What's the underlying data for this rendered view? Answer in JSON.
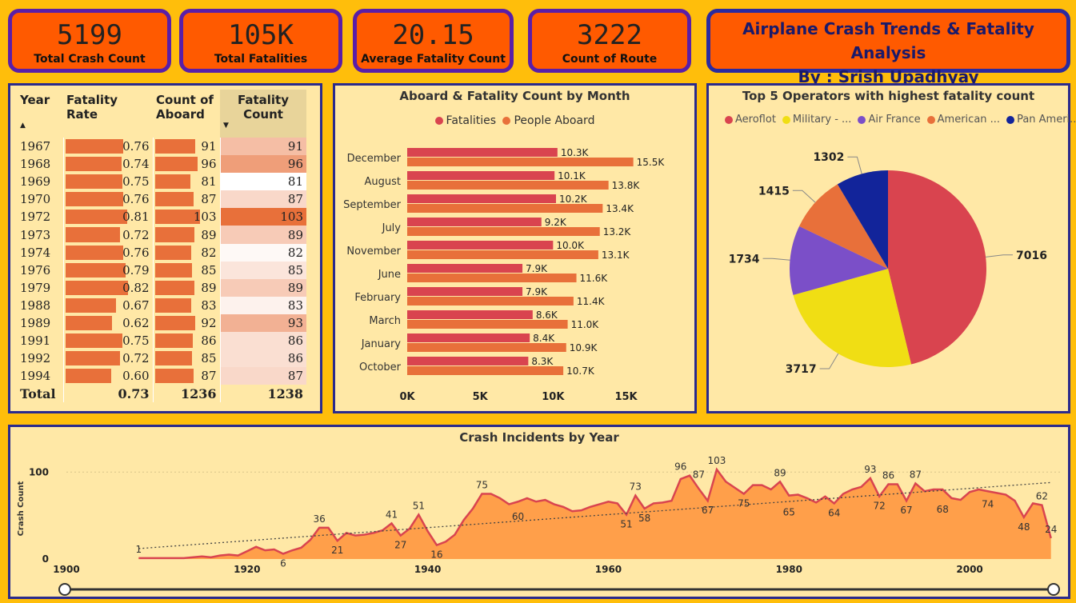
{
  "kpis": [
    {
      "value": "5199",
      "label": "Total Crash Count"
    },
    {
      "value": "105K",
      "label": "Total Fatalities"
    },
    {
      "value": "20.15",
      "label": "Average Fatality Count"
    },
    {
      "value": "3222",
      "label": "Count of Route"
    }
  ],
  "title": {
    "line1": "Airplane Crash Trends & Fatality Analysis",
    "line2": "By : Srish Upadhyay"
  },
  "table": {
    "headers": [
      "Year",
      "Fatality Rate",
      "Count of Aboard",
      "Fatality Count"
    ],
    "rows": [
      {
        "year": "1967",
        "rate": 0.76,
        "rate_txt": "0.76",
        "aboard": 91,
        "fat": 91
      },
      {
        "year": "1968",
        "rate": 0.74,
        "rate_txt": "0.74",
        "aboard": 96,
        "fat": 96
      },
      {
        "year": "1969",
        "rate": 0.75,
        "rate_txt": "0.75",
        "aboard": 81,
        "fat": 81
      },
      {
        "year": "1970",
        "rate": 0.76,
        "rate_txt": "0.76",
        "aboard": 87,
        "fat": 87
      },
      {
        "year": "1972",
        "rate": 0.81,
        "rate_txt": "0.81",
        "aboard": 103,
        "fat": 103
      },
      {
        "year": "1973",
        "rate": 0.72,
        "rate_txt": "0.72",
        "aboard": 89,
        "fat": 89
      },
      {
        "year": "1974",
        "rate": 0.76,
        "rate_txt": "0.76",
        "aboard": 82,
        "fat": 82
      },
      {
        "year": "1976",
        "rate": 0.79,
        "rate_txt": "0.79",
        "aboard": 85,
        "fat": 85
      },
      {
        "year": "1979",
        "rate": 0.82,
        "rate_txt": "0.82",
        "aboard": 89,
        "fat": 89
      },
      {
        "year": "1988",
        "rate": 0.67,
        "rate_txt": "0.67",
        "aboard": 83,
        "fat": 83
      },
      {
        "year": "1989",
        "rate": 0.62,
        "rate_txt": "0.62",
        "aboard": 92,
        "fat": 93
      },
      {
        "year": "1991",
        "rate": 0.75,
        "rate_txt": "0.75",
        "aboard": 86,
        "fat": 86
      },
      {
        "year": "1992",
        "rate": 0.72,
        "rate_txt": "0.72",
        "aboard": 85,
        "fat": 86
      },
      {
        "year": "1994",
        "rate": 0.6,
        "rate_txt": "0.60",
        "aboard": 87,
        "fat": 87
      }
    ],
    "total": {
      "label": "Total",
      "rate": "0.73",
      "aboard": "1236",
      "fat": "1238"
    },
    "colors": {
      "bar": "#E8703A"
    }
  },
  "chart_data": [
    {
      "type": "bar",
      "orientation": "horizontal",
      "title": "Aboard & Fatality Count by Month",
      "categories": [
        "December",
        "August",
        "September",
        "July",
        "November",
        "June",
        "February",
        "March",
        "January",
        "October"
      ],
      "series": [
        {
          "name": "Fatalities",
          "color": "#D9444F",
          "values": [
            10300,
            10100,
            10200,
            9200,
            10000,
            7900,
            7900,
            8600,
            8400,
            8300
          ],
          "labels": [
            "10.3K",
            "10.1K",
            "10.2K",
            "9.2K",
            "10.0K",
            "7.9K",
            "7.9K",
            "8.6K",
            "8.4K",
            "8.3K"
          ]
        },
        {
          "name": "People Aboard",
          "color": "#E8703A",
          "values": [
            15500,
            13800,
            13400,
            13200,
            13100,
            11600,
            11400,
            11000,
            10900,
            10700
          ],
          "labels": [
            "15.5K",
            "13.8K",
            "13.4K",
            "13.2K",
            "13.1K",
            "11.6K",
            "11.4K",
            "11.0K",
            "10.9K",
            "10.7K"
          ]
        }
      ],
      "xticks": [
        "0K",
        "5K",
        "10K",
        "15K"
      ],
      "xlim": [
        0,
        17000
      ],
      "legend": "top"
    },
    {
      "type": "pie",
      "title": "Top 5 Operators with highest fatality count",
      "legend_labels": [
        "Aeroflot",
        "Military - ...",
        "Air France",
        "American ...",
        "Pan Ameri..."
      ],
      "slices": [
        {
          "label": "Aeroflot",
          "value": 7016,
          "color": "#D9444F"
        },
        {
          "label": "Military",
          "value": 3717,
          "color": "#F0DE14"
        },
        {
          "label": "Air France",
          "value": 1734,
          "color": "#7B4FC8"
        },
        {
          "label": "American",
          "value": 1415,
          "color": "#E8703A"
        },
        {
          "label": "Pan American",
          "value": 1302,
          "color": "#12249A"
        }
      ],
      "legend": "top"
    },
    {
      "type": "area",
      "title": "Crash Incidents by Year",
      "ylabel": "Crash Count",
      "xticks": [
        "1900",
        "1920",
        "1940",
        "1960",
        "1980",
        "2000"
      ],
      "yticks": [
        "0",
        "100"
      ],
      "xlim": [
        1900,
        2010
      ],
      "ylim": [
        0,
        115
      ],
      "x": [
        1908,
        1910,
        1912,
        1913,
        1915,
        1916,
        1917,
        1918,
        1919,
        1920,
        1921,
        1922,
        1923,
        1924,
        1925,
        1926,
        1927,
        1928,
        1929,
        1930,
        1931,
        1932,
        1933,
        1934,
        1935,
        1936,
        1937,
        1938,
        1939,
        1940,
        1941,
        1942,
        1943,
        1944,
        1945,
        1946,
        1947,
        1948,
        1949,
        1950,
        1951,
        1952,
        1953,
        1954,
        1955,
        1956,
        1957,
        1958,
        1959,
        1960,
        1961,
        1962,
        1963,
        1964,
        1965,
        1966,
        1967,
        1968,
        1969,
        1970,
        1971,
        1972,
        1973,
        1974,
        1975,
        1976,
        1977,
        1978,
        1979,
        1980,
        1981,
        1982,
        1983,
        1984,
        1985,
        1986,
        1987,
        1988,
        1989,
        1990,
        1991,
        1992,
        1993,
        1994,
        1995,
        1996,
        1997,
        1998,
        1999,
        2000,
        2001,
        2002,
        2003,
        2004,
        2005,
        2006,
        2007,
        2008,
        2009
      ],
      "y": [
        1,
        1,
        1,
        1,
        3,
        2,
        4,
        5,
        4,
        9,
        14,
        10,
        11,
        6,
        10,
        13,
        22,
        36,
        36,
        21,
        30,
        27,
        28,
        30,
        33,
        41,
        27,
        35,
        51,
        32,
        16,
        20,
        28,
        45,
        58,
        75,
        75,
        70,
        63,
        66,
        70,
        66,
        68,
        63,
        60,
        55,
        56,
        60,
        63,
        66,
        64,
        51,
        73,
        58,
        64,
        65,
        67,
        92,
        96,
        81,
        67,
        103,
        89,
        82,
        75,
        85,
        85,
        80,
        89,
        73,
        74,
        70,
        65,
        72,
        64,
        75,
        80,
        83,
        93,
        72,
        86,
        86,
        67,
        87,
        78,
        80,
        80,
        70,
        68,
        77,
        80,
        78,
        76,
        74,
        67,
        48,
        64,
        62,
        24
      ],
      "labels": [
        {
          "x": 1908,
          "y": 1,
          "t": "1"
        },
        {
          "x": 1924,
          "y": 6,
          "t": "6"
        },
        {
          "x": 1928,
          "y": 36,
          "t": "36"
        },
        {
          "x": 1930,
          "y": 21,
          "t": "21"
        },
        {
          "x": 1936,
          "y": 41,
          "t": "41"
        },
        {
          "x": 1937,
          "y": 27,
          "t": "27"
        },
        {
          "x": 1939,
          "y": 51,
          "t": "51"
        },
        {
          "x": 1941,
          "y": 16,
          "t": "16"
        },
        {
          "x": 1946,
          "y": 75,
          "t": "75"
        },
        {
          "x": 1950,
          "y": 60,
          "t": "60"
        },
        {
          "x": 1962,
          "y": 51,
          "t": "51"
        },
        {
          "x": 1963,
          "y": 73,
          "t": "73"
        },
        {
          "x": 1964,
          "y": 58,
          "t": "58"
        },
        {
          "x": 1968,
          "y": 96,
          "t": "96"
        },
        {
          "x": 1970,
          "y": 87,
          "t": "87"
        },
        {
          "x": 1971,
          "y": 67,
          "t": "67"
        },
        {
          "x": 1972,
          "y": 103,
          "t": "103"
        },
        {
          "x": 1975,
          "y": 75,
          "t": "75"
        },
        {
          "x": 1979,
          "y": 89,
          "t": "89"
        },
        {
          "x": 1980,
          "y": 65,
          "t": "65"
        },
        {
          "x": 1985,
          "y": 64,
          "t": "64"
        },
        {
          "x": 1989,
          "y": 93,
          "t": "93"
        },
        {
          "x": 1990,
          "y": 72,
          "t": "72"
        },
        {
          "x": 1991,
          "y": 86,
          "t": "86"
        },
        {
          "x": 1993,
          "y": 67,
          "t": "67"
        },
        {
          "x": 1994,
          "y": 87,
          "t": "87"
        },
        {
          "x": 1997,
          "y": 68,
          "t": "68"
        },
        {
          "x": 2002,
          "y": 74,
          "t": "74"
        },
        {
          "x": 2006,
          "y": 48,
          "t": "48"
        },
        {
          "x": 2008,
          "y": 62,
          "t": "62"
        },
        {
          "x": 2009,
          "y": 24,
          "t": "24"
        }
      ],
      "trend": [
        {
          "x": 1908,
          "y": 12
        },
        {
          "x": 2009,
          "y": 88
        }
      ],
      "colors": {
        "fill": "#FF9F4A",
        "line": "#D9444F"
      }
    }
  ]
}
